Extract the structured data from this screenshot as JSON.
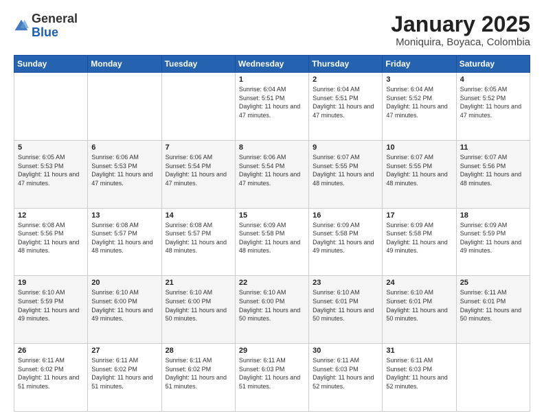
{
  "logo": {
    "general": "General",
    "blue": "Blue"
  },
  "title": "January 2025",
  "subtitle": "Moniquira, Boyaca, Colombia",
  "days_header": [
    "Sunday",
    "Monday",
    "Tuesday",
    "Wednesday",
    "Thursday",
    "Friday",
    "Saturday"
  ],
  "weeks": [
    [
      {
        "day": "",
        "info": ""
      },
      {
        "day": "",
        "info": ""
      },
      {
        "day": "",
        "info": ""
      },
      {
        "day": "1",
        "info": "Sunrise: 6:04 AM\nSunset: 5:51 PM\nDaylight: 11 hours and 47 minutes."
      },
      {
        "day": "2",
        "info": "Sunrise: 6:04 AM\nSunset: 5:51 PM\nDaylight: 11 hours and 47 minutes."
      },
      {
        "day": "3",
        "info": "Sunrise: 6:04 AM\nSunset: 5:52 PM\nDaylight: 11 hours and 47 minutes."
      },
      {
        "day": "4",
        "info": "Sunrise: 6:05 AM\nSunset: 5:52 PM\nDaylight: 11 hours and 47 minutes."
      }
    ],
    [
      {
        "day": "5",
        "info": "Sunrise: 6:05 AM\nSunset: 5:53 PM\nDaylight: 11 hours and 47 minutes."
      },
      {
        "day": "6",
        "info": "Sunrise: 6:06 AM\nSunset: 5:53 PM\nDaylight: 11 hours and 47 minutes."
      },
      {
        "day": "7",
        "info": "Sunrise: 6:06 AM\nSunset: 5:54 PM\nDaylight: 11 hours and 47 minutes."
      },
      {
        "day": "8",
        "info": "Sunrise: 6:06 AM\nSunset: 5:54 PM\nDaylight: 11 hours and 47 minutes."
      },
      {
        "day": "9",
        "info": "Sunrise: 6:07 AM\nSunset: 5:55 PM\nDaylight: 11 hours and 48 minutes."
      },
      {
        "day": "10",
        "info": "Sunrise: 6:07 AM\nSunset: 5:55 PM\nDaylight: 11 hours and 48 minutes."
      },
      {
        "day": "11",
        "info": "Sunrise: 6:07 AM\nSunset: 5:56 PM\nDaylight: 11 hours and 48 minutes."
      }
    ],
    [
      {
        "day": "12",
        "info": "Sunrise: 6:08 AM\nSunset: 5:56 PM\nDaylight: 11 hours and 48 minutes."
      },
      {
        "day": "13",
        "info": "Sunrise: 6:08 AM\nSunset: 5:57 PM\nDaylight: 11 hours and 48 minutes."
      },
      {
        "day": "14",
        "info": "Sunrise: 6:08 AM\nSunset: 5:57 PM\nDaylight: 11 hours and 48 minutes."
      },
      {
        "day": "15",
        "info": "Sunrise: 6:09 AM\nSunset: 5:58 PM\nDaylight: 11 hours and 48 minutes."
      },
      {
        "day": "16",
        "info": "Sunrise: 6:09 AM\nSunset: 5:58 PM\nDaylight: 11 hours and 49 minutes."
      },
      {
        "day": "17",
        "info": "Sunrise: 6:09 AM\nSunset: 5:58 PM\nDaylight: 11 hours and 49 minutes."
      },
      {
        "day": "18",
        "info": "Sunrise: 6:09 AM\nSunset: 5:59 PM\nDaylight: 11 hours and 49 minutes."
      }
    ],
    [
      {
        "day": "19",
        "info": "Sunrise: 6:10 AM\nSunset: 5:59 PM\nDaylight: 11 hours and 49 minutes."
      },
      {
        "day": "20",
        "info": "Sunrise: 6:10 AM\nSunset: 6:00 PM\nDaylight: 11 hours and 49 minutes."
      },
      {
        "day": "21",
        "info": "Sunrise: 6:10 AM\nSunset: 6:00 PM\nDaylight: 11 hours and 50 minutes."
      },
      {
        "day": "22",
        "info": "Sunrise: 6:10 AM\nSunset: 6:00 PM\nDaylight: 11 hours and 50 minutes."
      },
      {
        "day": "23",
        "info": "Sunrise: 6:10 AM\nSunset: 6:01 PM\nDaylight: 11 hours and 50 minutes."
      },
      {
        "day": "24",
        "info": "Sunrise: 6:10 AM\nSunset: 6:01 PM\nDaylight: 11 hours and 50 minutes."
      },
      {
        "day": "25",
        "info": "Sunrise: 6:11 AM\nSunset: 6:01 PM\nDaylight: 11 hours and 50 minutes."
      }
    ],
    [
      {
        "day": "26",
        "info": "Sunrise: 6:11 AM\nSunset: 6:02 PM\nDaylight: 11 hours and 51 minutes."
      },
      {
        "day": "27",
        "info": "Sunrise: 6:11 AM\nSunset: 6:02 PM\nDaylight: 11 hours and 51 minutes."
      },
      {
        "day": "28",
        "info": "Sunrise: 6:11 AM\nSunset: 6:02 PM\nDaylight: 11 hours and 51 minutes."
      },
      {
        "day": "29",
        "info": "Sunrise: 6:11 AM\nSunset: 6:03 PM\nDaylight: 11 hours and 51 minutes."
      },
      {
        "day": "30",
        "info": "Sunrise: 6:11 AM\nSunset: 6:03 PM\nDaylight: 11 hours and 52 minutes."
      },
      {
        "day": "31",
        "info": "Sunrise: 6:11 AM\nSunset: 6:03 PM\nDaylight: 11 hours and 52 minutes."
      },
      {
        "day": "",
        "info": ""
      }
    ]
  ]
}
